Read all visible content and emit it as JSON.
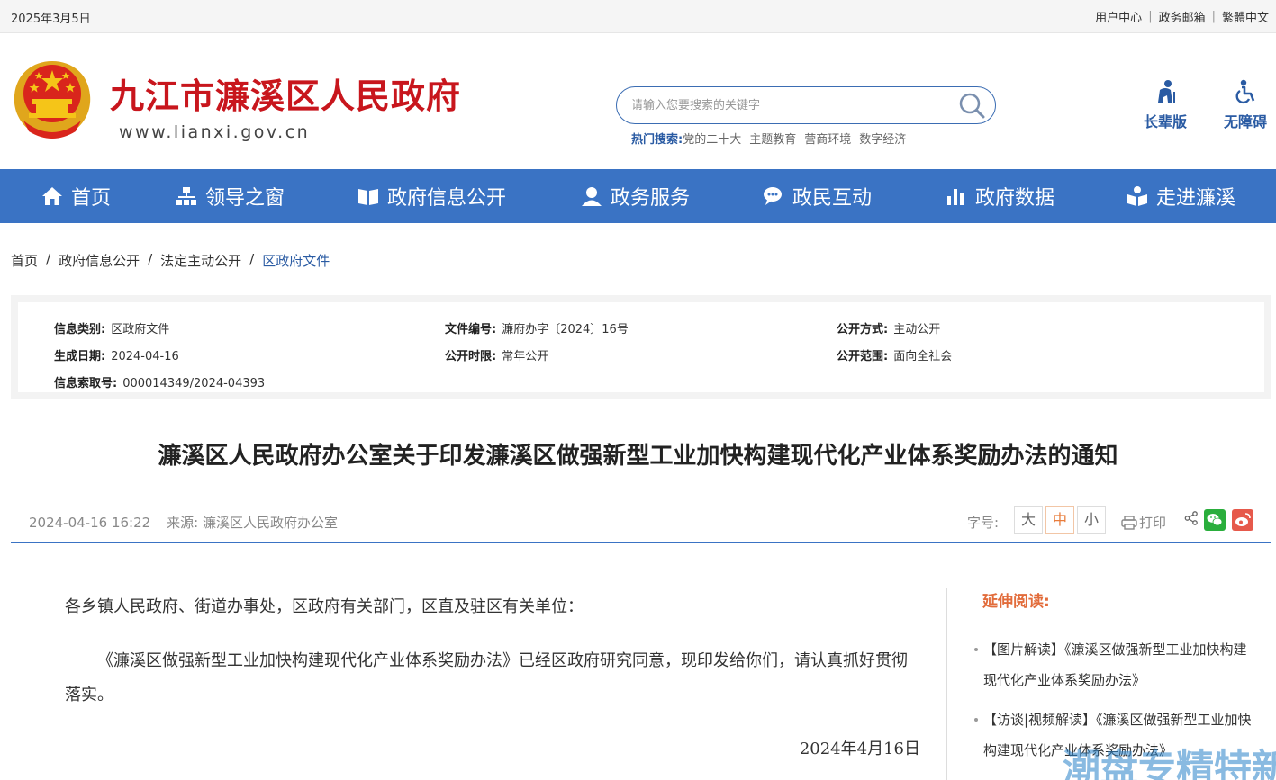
{
  "topbar": {
    "date": "2025年3月5日",
    "links": [
      "用户中心",
      "政务邮箱",
      "繁體中文"
    ]
  },
  "header": {
    "title": "九江市濂溪区人民政府",
    "domain": "www.lianxi.gov.cn",
    "search_placeholder": "请输入您要搜索的关键字",
    "hot_label": "热门搜索:",
    "hot_items": [
      "党的二十大",
      "主题教育",
      "营商环境",
      "数字经济"
    ],
    "quick": [
      "长辈版",
      "无障碍"
    ]
  },
  "nav": [
    "首页",
    "领导之窗",
    "政府信息公开",
    "政务服务",
    "政民互动",
    "政府数据",
    "走进濂溪"
  ],
  "breadcrumb": [
    "首页",
    "政府信息公开",
    "法定主动公开",
    "区政府文件"
  ],
  "meta": {
    "category_k": "信息类别:",
    "category_v": "区政府文件",
    "docno_k": "文件编号:",
    "docno_v": "濂府办字〔2024〕16号",
    "pubmode_k": "公开方式:",
    "pubmode_v": "主动公开",
    "date_k": "生成日期:",
    "date_v": "2024-04-16",
    "period_k": "公开时限:",
    "period_v": "常年公开",
    "scope_k": "公开范围:",
    "scope_v": "面向全社会",
    "index_k": "信息索取号:",
    "index_v": "000014349/2024-04393"
  },
  "article": {
    "title": "濂溪区人民政府办公室关于印发濂溪区做强新型工业加快构建现代化产业体系奖励办法的通知",
    "datetime": "2024-04-16 16:22",
    "source": "来源:  濂溪区人民政府办公室",
    "fontsize_label": "字号:",
    "fontsizes": [
      "大",
      "中",
      "小"
    ],
    "print_label": "打印",
    "para1": "各乡镇人民政府、街道办事处，区政府有关部门，区直及驻区有关单位：",
    "para2": "《濂溪区做强新型工业加快构建现代化产业体系奖励办法》已经区政府研究同意，现印发给你们，请认真抓好贯彻落实。",
    "sign_date": "2024年4月16日"
  },
  "related": {
    "heading": "延伸阅读:",
    "items": [
      "【图片解读】《濂溪区做强新型工业加快构建现代化产业体系奖励办法》",
      "【访谈|视频解读】《濂溪区做强新型工业加快构建现代化产业体系奖励办法》"
    ]
  },
  "watermark": "潮盘专精特新",
  "colors": {
    "brand_red": "#c8161d",
    "nav_blue": "#3a73c4",
    "link_blue": "#2a5ba3",
    "accent_orange": "#e26c3b"
  }
}
